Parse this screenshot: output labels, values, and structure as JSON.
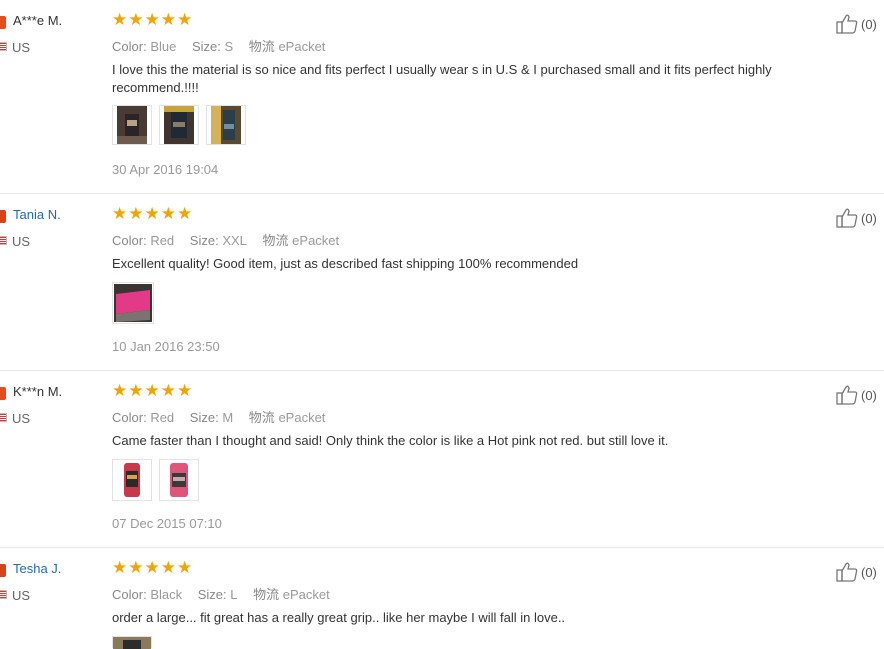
{
  "labels": {
    "color": "Color:",
    "size": "Size:",
    "shipping": "物流"
  },
  "reviews": [
    {
      "name": "A***e M.",
      "country": "US",
      "color": "Blue",
      "size": "S",
      "shipping": "ePacket",
      "text": "I love this the material is so nice and fits perfect I usually wear s in U.S & I purchased small and it fits perfect highly recommend.!!!!",
      "date": "30 Apr 2016 19:04",
      "helpful": "(0)"
    },
    {
      "name": "Tania N.",
      "country": "US",
      "color": "Red",
      "size": "XXL",
      "shipping": "ePacket",
      "text": "Excellent quality! Good item, just as described fast shipping 100% recommended",
      "date": "10 Jan 2016 23:50",
      "helpful": "(0)"
    },
    {
      "name": "K***n M.",
      "country": "US",
      "color": "Red",
      "size": "M",
      "shipping": "ePacket",
      "text": "Came faster than I thought and said! Only think the color is like a Hot pink not red. but still love it.",
      "date": "07 Dec 2015 07:10",
      "helpful": "(0)"
    },
    {
      "name": "Tesha J.",
      "country": "US",
      "color": "Black",
      "size": "L",
      "shipping": "ePacket",
      "text": "order a large... fit great has a really great grip.. like her maybe I will fall in love..",
      "helpful": "(0)"
    }
  ]
}
